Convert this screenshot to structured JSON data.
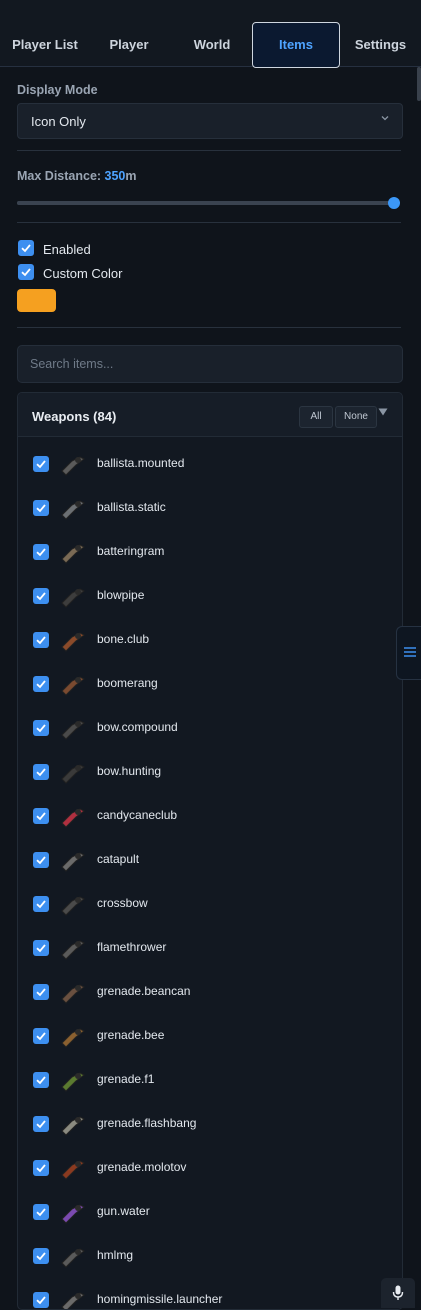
{
  "tabs": [
    {
      "label": "Player List",
      "active": false
    },
    {
      "label": "Player",
      "active": false
    },
    {
      "label": "World",
      "active": false
    },
    {
      "label": "Items",
      "active": true
    },
    {
      "label": "Settings",
      "active": false
    }
  ],
  "display_mode": {
    "label": "Display Mode",
    "value": "Icon Only"
  },
  "max_distance": {
    "label": "Max Distance: ",
    "value": "350",
    "unit": "m",
    "fraction": 1.0
  },
  "options": {
    "enabled": {
      "label": "Enabled",
      "checked": true
    },
    "custom_color": {
      "label": "Custom Color",
      "checked": true,
      "color": "#f5a020"
    }
  },
  "search": {
    "placeholder": "Search items..."
  },
  "category": {
    "title": "Weapons (84)",
    "all_label": "All",
    "none_label": "None",
    "items": [
      {
        "name": "ballista.mounted",
        "checked": true,
        "icon": "ballista-icon"
      },
      {
        "name": "ballista.static",
        "checked": true,
        "icon": "ballista-icon"
      },
      {
        "name": "batteringram",
        "checked": true,
        "icon": "ram-icon"
      },
      {
        "name": "blowpipe",
        "checked": true,
        "icon": "pipe-icon"
      },
      {
        "name": "bone.club",
        "checked": true,
        "icon": "club-icon"
      },
      {
        "name": "boomerang",
        "checked": true,
        "icon": "boomerang-icon"
      },
      {
        "name": "bow.compound",
        "checked": true,
        "icon": "bow-icon"
      },
      {
        "name": "bow.hunting",
        "checked": true,
        "icon": "bow-icon"
      },
      {
        "name": "candycaneclub",
        "checked": true,
        "icon": "candycane-icon"
      },
      {
        "name": "catapult",
        "checked": true,
        "icon": "catapult-icon"
      },
      {
        "name": "crossbow",
        "checked": true,
        "icon": "crossbow-icon"
      },
      {
        "name": "flamethrower",
        "checked": true,
        "icon": "flamethrower-icon"
      },
      {
        "name": "grenade.beancan",
        "checked": true,
        "icon": "can-icon"
      },
      {
        "name": "grenade.bee",
        "checked": true,
        "icon": "can-icon"
      },
      {
        "name": "grenade.f1",
        "checked": true,
        "icon": "grenade-icon"
      },
      {
        "name": "grenade.flashbang",
        "checked": true,
        "icon": "can-icon"
      },
      {
        "name": "grenade.molotov",
        "checked": true,
        "icon": "bottle-icon"
      },
      {
        "name": "gun.water",
        "checked": true,
        "icon": "watergun-icon"
      },
      {
        "name": "hmlmg",
        "checked": true,
        "icon": "rifle-icon"
      },
      {
        "name": "homingmissile.launcher",
        "checked": true,
        "icon": "launcher-icon"
      }
    ]
  },
  "colors": {
    "accent": "#3d8ff0",
    "background": "#0f141b"
  }
}
